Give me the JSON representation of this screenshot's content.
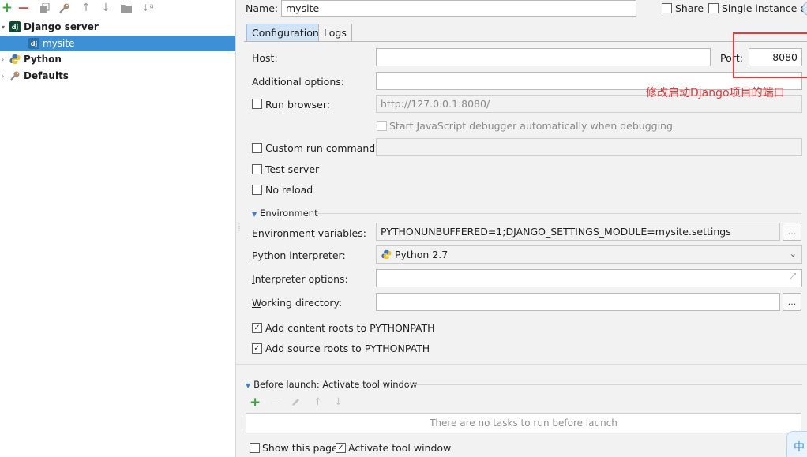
{
  "toolbar": {
    "icons": [
      "add-icon",
      "remove-icon",
      "copy-icon",
      "wrench-icon",
      "move-up-icon",
      "move-down-icon",
      "folder-icon",
      "sort-icon"
    ],
    "add_glyph": "+",
    "remove_glyph": "—",
    "up_glyph": "↑",
    "down_glyph": "↓",
    "sort_glyph": "↓ª"
  },
  "tree": {
    "django_icon_text": "dj",
    "django_server": "Django server",
    "mysite": "mysite",
    "python": "Python",
    "defaults": "Defaults"
  },
  "header": {
    "name_label": "Name:",
    "name_value": "mysite",
    "share_label": "Share",
    "single_instance_label": "Single instance only"
  },
  "tabs": {
    "configuration": "Configuration",
    "logs": "Logs"
  },
  "form": {
    "host_label": "Host:",
    "host_value": "",
    "port_label": "Port:",
    "port_value": "8080",
    "additional_options_label": "Additional options:",
    "additional_options_value": "",
    "run_browser_label": "Run browser:",
    "run_browser_url": "http://127.0.0.1:8080/",
    "js_debugger_label": "Start JavaScript debugger automatically when debugging",
    "custom_run_command_label": "Custom run command:",
    "custom_run_command_value": "",
    "test_server_label": "Test server",
    "no_reload_label": "No reload"
  },
  "environment": {
    "section_title": "Environment",
    "env_vars_label": "Environment variables:",
    "env_vars_value": "PYTHONUNBUFFERED=1;DJANGO_SETTINGS_MODULE=mysite.settings",
    "browse_label": "...",
    "python_interpreter_label": "Python interpreter:",
    "python_interpreter_value": "Python 2.7",
    "interpreter_options_label": "Interpreter options:",
    "interpreter_options_value": "",
    "working_directory_label": "Working directory:",
    "working_directory_value": "",
    "add_content_roots_label": "Add content roots to PYTHONPATH",
    "add_source_roots_label": "Add source roots to PYTHONPATH"
  },
  "before_launch": {
    "title": "Before launch: Activate tool window",
    "empty_text": "There are no tasks to run before launch",
    "add_glyph": "+",
    "remove_glyph": "—",
    "up_glyph": "↑",
    "down_glyph": "↓"
  },
  "footer": {
    "show_this_page_label": "Show this page",
    "activate_tool_window_label": "Activate tool window"
  },
  "annotation": {
    "note": "修改启动Django项目的端口",
    "color": "#e63b3b"
  },
  "corner_badge": "中",
  "checkbox_states": {
    "share": false,
    "single_instance": false,
    "run_browser": false,
    "js_debugger": false,
    "custom_run_command": false,
    "test_server": false,
    "no_reload": false,
    "add_content_roots": true,
    "add_source_roots": true,
    "show_this_page": false,
    "activate_tool_window": true
  },
  "check_glyph": "✓",
  "colors": {
    "selection": "#3d8fd6",
    "tab_active": "#d0e4f5",
    "annotation_red": "#e63b3b"
  }
}
